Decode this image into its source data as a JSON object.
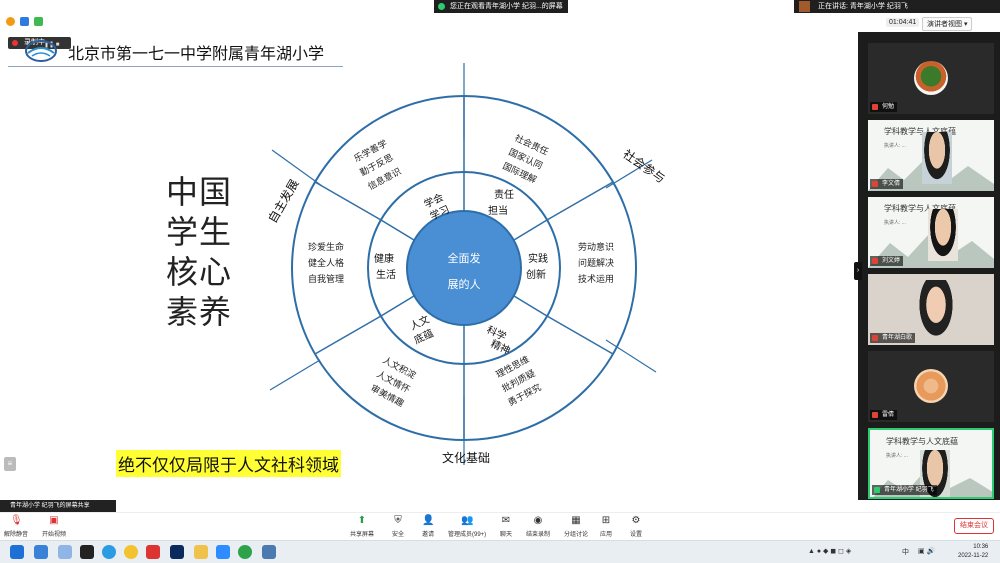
{
  "top": {
    "share_banner": "您正在观看青年湖小学 纪羽...的屏幕",
    "speaking_banner": "正在讲话: 青年湖小学 纪羽飞",
    "timer": "01:04:41",
    "view_button": "演讲者视图 ▾"
  },
  "recording": {
    "label": "录制中"
  },
  "slide": {
    "school_name": "北京市第一七一中学附属青年湖小学",
    "vertical_title": "中国学生核心素养",
    "highlight_text": "绝不仅仅局限于人文社科领域",
    "center": [
      "全面发",
      "展的人"
    ],
    "domains": {
      "zizhu": "自主发展",
      "shehui": "社会参与",
      "wenhua": "文化基础"
    },
    "inner_ring": {
      "xuehui": "学会学习",
      "zeren": "责任担当",
      "shijian": "实践创新",
      "kexue": "科学精神",
      "renwen": "人文底蕴",
      "jiankang": "健康生活"
    },
    "outer_ring": {
      "xuehui": [
        "乐学善学",
        "勤于反思",
        "信息意识"
      ],
      "zeren": [
        "社会责任",
        "国家认同",
        "国际理解"
      ],
      "shijian": [
        "劳动意识",
        "问题解决",
        "技术运用"
      ],
      "kexue": [
        "理性思维",
        "批判质疑",
        "勇于探究"
      ],
      "renwen": [
        "人文积淀",
        "人文情怀",
        "审美情趣"
      ],
      "jiankang": [
        "珍爱生命",
        "健全人格",
        "自我管理"
      ]
    }
  },
  "panel": {
    "tiles": [
      {
        "name": "何勉",
        "kind": "avatar"
      },
      {
        "name": "李文倩",
        "kind": "slide"
      },
      {
        "name": "刘文婷",
        "kind": "slide"
      },
      {
        "name": "青年湖白歌",
        "kind": "video"
      },
      {
        "name": "雷倩",
        "kind": "avatar"
      },
      {
        "name": "青年湖小学 纪羽飞",
        "kind": "slide"
      }
    ],
    "slide_tile_title": "学科教学与人文底蕴",
    "slide_tile_sub": "执讲人: ..."
  },
  "bottom_share_label": "青年湖小学 纪羽飞的屏幕共享",
  "toolbar": {
    "mute": "解除静音",
    "video": "开始视频",
    "share": "共享屏幕",
    "security": "安全",
    "invite": "邀请",
    "participants": "管理成员(99+)",
    "chat": "聊天",
    "record": "结束录制",
    "breakout": "分组讨论",
    "apps": "应用",
    "settings": "设置",
    "end": "结束会议"
  },
  "taskbar": {
    "ime": "中",
    "time": "10:36",
    "date": "2022-11-22"
  },
  "colors": {
    "ring": "#2e6ea8",
    "center": "#4a8ed4",
    "highlight": "#ffff33",
    "panel_bg": "#1c1c1c",
    "end_red": "#dd3333"
  }
}
